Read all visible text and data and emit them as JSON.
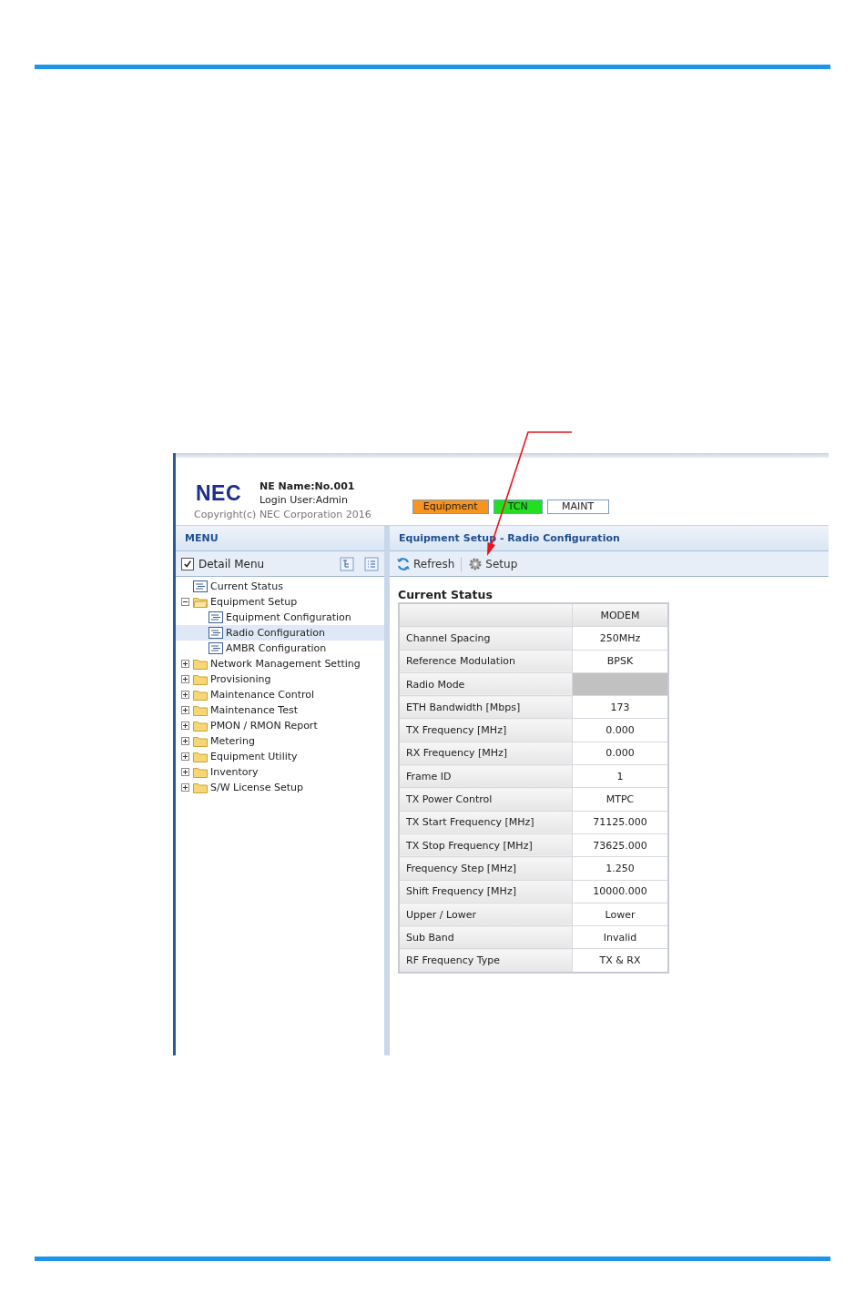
{
  "header": {
    "logo": "NEC",
    "ne_name": "NE Name:No.001",
    "login_user": "Login User:Admin",
    "copyright": "Copyright(c) NEC Corporation 2016",
    "badges": [
      {
        "label": "Equipment",
        "color": "#f7941d"
      },
      {
        "label": "TCN",
        "color": "#22e01f"
      },
      {
        "label": "MAINT",
        "color": "#ffffff"
      }
    ]
  },
  "menu": {
    "title": "MENU",
    "detail_menu": {
      "label": "Detail Menu",
      "checked": true
    },
    "tree": [
      {
        "label": "Current Status",
        "kind": "page",
        "selected": false
      },
      {
        "label": "Equipment Setup",
        "kind": "folder",
        "selected": false,
        "expanded": true,
        "children": [
          {
            "label": "Equipment Configuration",
            "kind": "page",
            "selected": false
          },
          {
            "label": "Radio Configuration",
            "kind": "page",
            "selected": true
          },
          {
            "label": "AMBR Configuration",
            "kind": "page",
            "selected": false
          }
        ]
      },
      {
        "label": "Network Management Setting",
        "kind": "folder",
        "selected": false,
        "expanded": false
      },
      {
        "label": "Provisioning",
        "kind": "folder",
        "selected": false,
        "expanded": false
      },
      {
        "label": "Maintenance Control",
        "kind": "folder",
        "selected": false,
        "expanded": false
      },
      {
        "label": "Maintenance Test",
        "kind": "folder",
        "selected": false,
        "expanded": false
      },
      {
        "label": "PMON / RMON Report",
        "kind": "folder",
        "selected": false,
        "expanded": false
      },
      {
        "label": "Metering",
        "kind": "folder",
        "selected": false,
        "expanded": false
      },
      {
        "label": "Equipment Utility",
        "kind": "folder",
        "selected": false,
        "expanded": false
      },
      {
        "label": "Inventory",
        "kind": "folder",
        "selected": false,
        "expanded": false
      },
      {
        "label": "S/W License Setup",
        "kind": "folder",
        "selected": false,
        "expanded": false
      }
    ]
  },
  "content": {
    "breadcrumb": "Equipment Setup - Radio Configuration",
    "toolbar": [
      {
        "label": "Refresh",
        "kind": "refresh"
      },
      {
        "label": "Setup",
        "kind": "setup"
      }
    ],
    "section_title": "Current Status",
    "table": {
      "column_header": "MODEM",
      "rows": [
        {
          "label": "Channel Spacing",
          "kind": "text",
          "value": "250MHz"
        },
        {
          "label": "Reference Modulation",
          "kind": "text",
          "value": "BPSK"
        },
        {
          "label": "Radio Mode",
          "kind": "unavailable"
        },
        {
          "label": "ETH Bandwidth [Mbps]",
          "kind": "text",
          "value": "173"
        },
        {
          "label": "TX Frequency [MHz]",
          "kind": "text",
          "value": "0.000"
        },
        {
          "label": "RX Frequency [MHz]",
          "kind": "text",
          "value": "0.000"
        },
        {
          "label": "Frame ID",
          "kind": "text",
          "value": "1"
        },
        {
          "label": "TX Power Control",
          "kind": "text",
          "value": "MTPC"
        },
        {
          "label": "TX Start Frequency [MHz]",
          "kind": "text",
          "value": "71125.000"
        },
        {
          "label": "TX Stop Frequency [MHz]",
          "kind": "text",
          "value": "73625.000"
        },
        {
          "label": "Frequency Step [MHz]",
          "kind": "text",
          "value": "1.250"
        },
        {
          "label": "Shift Frequency [MHz]",
          "kind": "text",
          "value": "10000.000"
        },
        {
          "label": "Upper / Lower",
          "kind": "text",
          "value": "Lower"
        },
        {
          "label": "Sub Band",
          "kind": "text",
          "value": "Invalid"
        },
        {
          "label": "RF Frequency Type",
          "kind": "text",
          "value": "TX & RX"
        }
      ]
    }
  }
}
